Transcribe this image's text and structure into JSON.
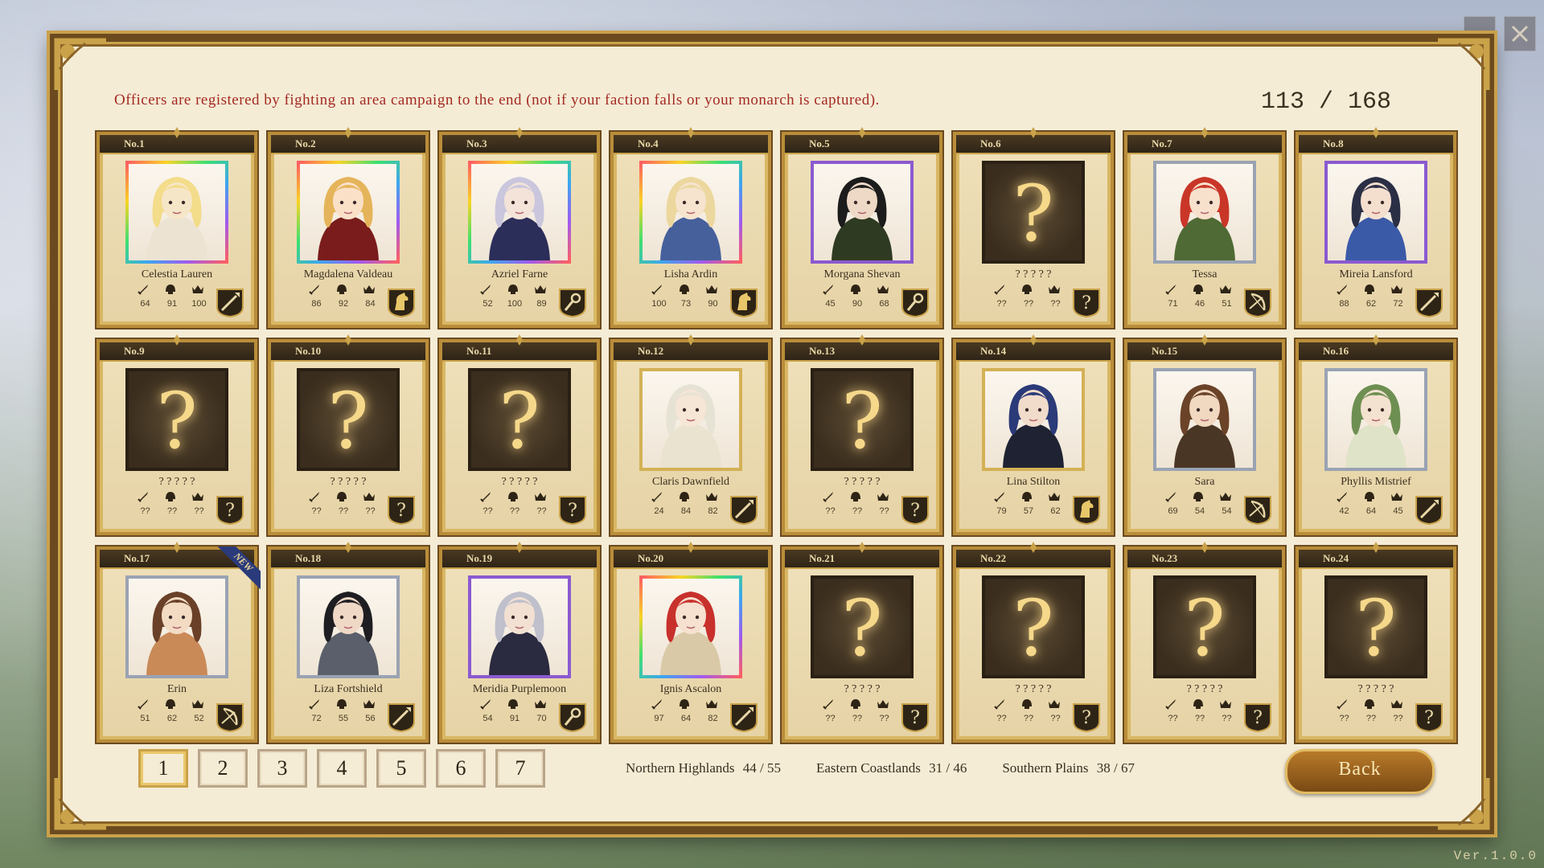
{
  "window": {
    "version": "Ver.1.0.0"
  },
  "header": {
    "notice": "Officers are registered by fighting an area campaign to the end (not if your faction falls or your monarch is captured).",
    "total": "113 / 168"
  },
  "officers": [
    {
      "no": "No.1",
      "name": "Celestia Lauren",
      "stats": [
        "64",
        "91",
        "100"
      ],
      "frame": "rainbow",
      "badge": "spear",
      "known": true,
      "hair": "#f3dc8a",
      "tone": "#f6e6c8",
      "outfit": "#ece3d3"
    },
    {
      "no": "No.2",
      "name": "Magdalena Valdeau",
      "stats": [
        "86",
        "92",
        "84"
      ],
      "frame": "rainbow",
      "badge": "horse",
      "known": true,
      "hair": "#e5b45a",
      "tone": "#fbe0c8",
      "outfit": "#7a1c1c"
    },
    {
      "no": "No.3",
      "name": "Azriel Farne",
      "stats": [
        "52",
        "100",
        "89"
      ],
      "frame": "rainbow",
      "badge": "staff",
      "known": true,
      "hair": "#c9c6dd",
      "tone": "#f4e3d8",
      "outfit": "#2c2e5a"
    },
    {
      "no": "No.4",
      "name": "Lisha Ardin",
      "stats": [
        "100",
        "73",
        "90"
      ],
      "frame": "rainbow",
      "badge": "horse",
      "known": true,
      "hair": "#ecd79e",
      "tone": "#f6e4cf",
      "outfit": "#46609c"
    },
    {
      "no": "No.5",
      "name": "Morgana Shevan",
      "stats": [
        "45",
        "90",
        "68"
      ],
      "frame": "purple",
      "badge": "staff",
      "known": true,
      "hair": "#1c1c1c",
      "tone": "#eed9c6",
      "outfit": "#2f3a22"
    },
    {
      "no": "No.6",
      "name": "? ? ? ? ?",
      "stats": [
        "??",
        "??",
        "??"
      ],
      "frame": "unknown",
      "badge": "unknown",
      "known": false
    },
    {
      "no": "No.7",
      "name": "Tessa",
      "stats": [
        "71",
        "46",
        "51"
      ],
      "frame": "silver",
      "badge": "bow",
      "known": true,
      "hair": "#c93628",
      "tone": "#f7e1cd",
      "outfit": "#4f6a34"
    },
    {
      "no": "No.8",
      "name": "Mireia Lansford",
      "stats": [
        "88",
        "62",
        "72"
      ],
      "frame": "purple",
      "badge": "spear",
      "known": true,
      "hair": "#2b2f45",
      "tone": "#f4dfcf",
      "outfit": "#3a5aa8"
    },
    {
      "no": "No.9",
      "name": "? ? ? ? ?",
      "stats": [
        "??",
        "??",
        "??"
      ],
      "frame": "unknown",
      "badge": "unknown",
      "known": false
    },
    {
      "no": "No.10",
      "name": "? ? ? ? ?",
      "stats": [
        "??",
        "??",
        "??"
      ],
      "frame": "unknown",
      "badge": "unknown",
      "known": false
    },
    {
      "no": "No.11",
      "name": "? ? ? ? ?",
      "stats": [
        "??",
        "??",
        "??"
      ],
      "frame": "unknown",
      "badge": "unknown",
      "known": false
    },
    {
      "no": "No.12",
      "name": "Claris Dawnfield",
      "stats": [
        "24",
        "84",
        "82"
      ],
      "frame": "gold",
      "badge": "spear",
      "known": true,
      "hair": "#e6e2d4",
      "tone": "#f6e6d6",
      "outfit": "#e9e3cf"
    },
    {
      "no": "No.13",
      "name": "? ? ? ? ?",
      "stats": [
        "??",
        "??",
        "??"
      ],
      "frame": "unknown",
      "badge": "unknown",
      "known": false
    },
    {
      "no": "No.14",
      "name": "Lina Stilton",
      "stats": [
        "79",
        "57",
        "62"
      ],
      "frame": "gold",
      "badge": "horse",
      "known": true,
      "hair": "#2b3a78",
      "tone": "#f1dccb",
      "outfit": "#1f2233"
    },
    {
      "no": "No.15",
      "name": "Sara",
      "stats": [
        "69",
        "54",
        "54"
      ],
      "frame": "silver",
      "badge": "bow",
      "known": true,
      "hair": "#6a4328",
      "tone": "#f1d8c0",
      "outfit": "#4a3624"
    },
    {
      "no": "No.16",
      "name": "Phyllis Mistrief",
      "stats": [
        "42",
        "64",
        "45"
      ],
      "frame": "silver",
      "badge": "spear",
      "known": true,
      "hair": "#6e8f52",
      "tone": "#f4e2d0",
      "outfit": "#dfe3c8"
    },
    {
      "no": "No.17",
      "name": "Erin",
      "stats": [
        "51",
        "62",
        "52"
      ],
      "frame": "silver",
      "badge": "bow",
      "known": true,
      "new": "NEW",
      "hair": "#6a4028",
      "tone": "#f3dbc3",
      "outfit": "#c98a58"
    },
    {
      "no": "No.18",
      "name": "Liza Fortshield",
      "stats": [
        "72",
        "55",
        "56"
      ],
      "frame": "silver",
      "badge": "spear",
      "known": true,
      "hair": "#1e1e22",
      "tone": "#efd8c6",
      "outfit": "#5a5f6b"
    },
    {
      "no": "No.19",
      "name": "Meridia Purplemoon",
      "stats": [
        "54",
        "91",
        "70"
      ],
      "frame": "purple",
      "badge": "staff",
      "known": true,
      "hair": "#bfc0cc",
      "tone": "#f2e0d2",
      "outfit": "#2a2a40"
    },
    {
      "no": "No.20",
      "name": "Ignis Ascalon",
      "stats": [
        "97",
        "64",
        "82"
      ],
      "frame": "rainbow",
      "badge": "spear",
      "known": true,
      "hair": "#c8302c",
      "tone": "#f6e0cf",
      "outfit": "#d9c9a6"
    },
    {
      "no": "No.21",
      "name": "? ? ? ? ?",
      "stats": [
        "??",
        "??",
        "??"
      ],
      "frame": "unknown",
      "badge": "unknown",
      "known": false
    },
    {
      "no": "No.22",
      "name": "? ? ? ? ?",
      "stats": [
        "??",
        "??",
        "??"
      ],
      "frame": "unknown",
      "badge": "unknown",
      "known": false
    },
    {
      "no": "No.23",
      "name": "? ? ? ? ?",
      "stats": [
        "??",
        "??",
        "??"
      ],
      "frame": "unknown",
      "badge": "unknown",
      "known": false
    },
    {
      "no": "No.24",
      "name": "? ? ? ? ?",
      "stats": [
        "??",
        "??",
        "??"
      ],
      "frame": "unknown",
      "badge": "unknown",
      "known": false
    }
  ],
  "pagination": {
    "pages": [
      "1",
      "2",
      "3",
      "4",
      "5",
      "6",
      "7"
    ],
    "current": "1"
  },
  "regions": [
    {
      "label": "Northern Highlands",
      "value": "44 / 55"
    },
    {
      "label": "Eastern Coastlands",
      "value": "31 / 46"
    },
    {
      "label": "Southern Plains",
      "value": "38 / 67"
    }
  ],
  "footer": {
    "back_label": "Back"
  },
  "colors": {
    "notice": "#a42a22",
    "gold": "#c9a24a",
    "panel": "#f5ecd6",
    "frame_dark": "#6b4a1f"
  },
  "icons": {
    "stat_icons": [
      "sword-icon",
      "helmet-icon",
      "crown-icon"
    ],
    "badges": [
      "spear-icon",
      "horse-icon",
      "staff-icon",
      "bow-icon",
      "question-icon"
    ]
  }
}
